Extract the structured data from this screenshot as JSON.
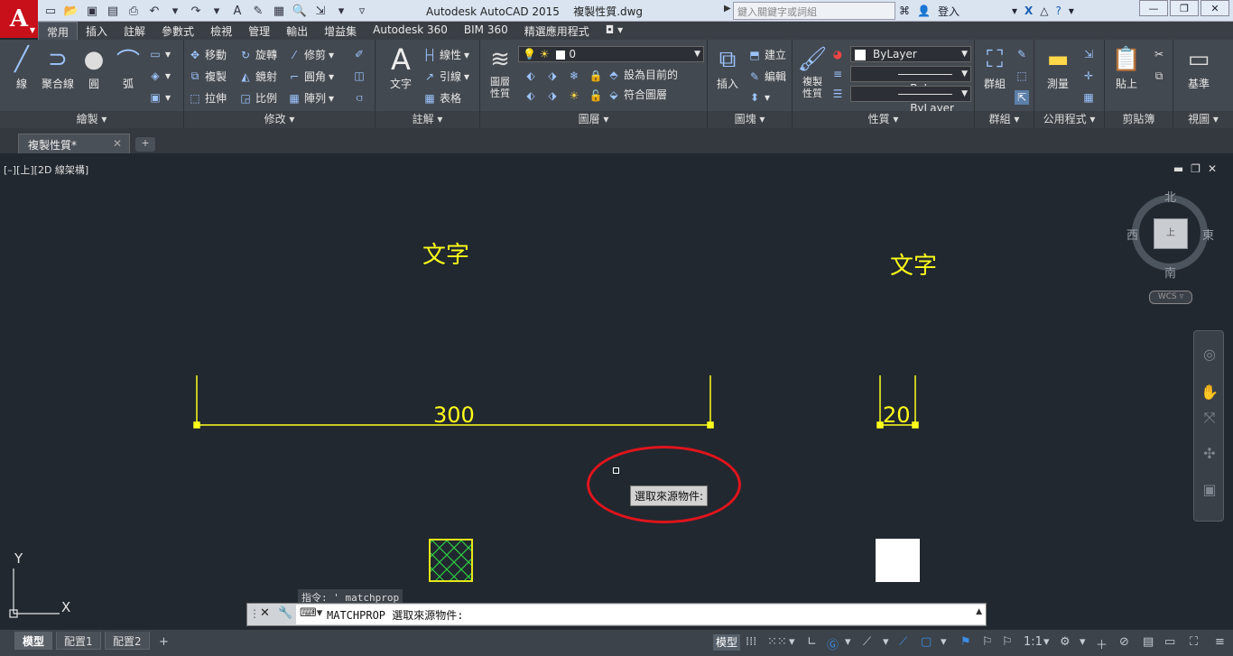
{
  "title_bar": {
    "app_title": "Autodesk AutoCAD 2015",
    "file_name": "複製性質.dwg",
    "search_placeholder": "鍵入關鍵字或詞組",
    "sign_in": "登入"
  },
  "ribbon_tabs": [
    "常用",
    "插入",
    "註解",
    "參數式",
    "檢視",
    "管理",
    "輸出",
    "增益集",
    "Autodesk 360",
    "BIM 360",
    "精選應用程式"
  ],
  "ribbon": {
    "draw": {
      "title": "繪製",
      "line": "線",
      "polyline": "聚合線",
      "circle": "圓",
      "arc": "弧"
    },
    "modify": {
      "title": "修改",
      "move": "移動",
      "rotate": "旋轉",
      "trim": "修剪",
      "copy": "複製",
      "mirror": "鏡射",
      "fillet": "圓角",
      "stretch": "拉伸",
      "scale": "比例",
      "array": "陣列"
    },
    "annotation": {
      "title": "註解",
      "text": "文字",
      "linear": "線性",
      "leader": "引線",
      "table": "表格"
    },
    "layers": {
      "title": "圖層",
      "layer_properties": "圖層\n性質",
      "current_layer": "0",
      "make_current": "設為目前的",
      "match_layer": "符合圖層"
    },
    "block": {
      "title": "圖塊",
      "insert": "插入",
      "create": "建立",
      "edit": "編輯"
    },
    "properties": {
      "title": "性質",
      "match_properties": "複製\n性質",
      "color": "ByLayer",
      "linetype": "ByLayer",
      "lineweight": "ByLayer"
    },
    "groups": {
      "title": "群組",
      "group": "群組"
    },
    "utilities": {
      "title": "公用程式",
      "measure": "測量"
    },
    "clipboard": {
      "title": "剪貼簿",
      "paste": "貼上"
    },
    "view": {
      "title": "視圖",
      "base": "基準"
    }
  },
  "file_tab": {
    "name": "複製性質*"
  },
  "viewport": {
    "label": "[–][上][2D 線架構]",
    "text_left": "文字",
    "text_right": "文字",
    "dim_left": "300",
    "dim_right": "20",
    "tooltip": "選取來源物件:"
  },
  "viewcube": {
    "north": "北",
    "south": "南",
    "east": "東",
    "west": "西",
    "wcs": "WCS"
  },
  "ucs": {
    "x_label": "X",
    "y_label": "Y"
  },
  "command": {
    "history": "指令: '_matchprop",
    "prompt": "MATCHPROP 選取來源物件:"
  },
  "status_bar": {
    "layout_tabs": [
      "模型",
      "配置1",
      "配置2"
    ],
    "model_button": "模型",
    "scale": "1:1"
  },
  "colors": {
    "accent_red": "#c8101a",
    "draw_yellow": "#ffff1a",
    "canvas_bg": "#212830",
    "annotation_red": "#e0141c"
  }
}
